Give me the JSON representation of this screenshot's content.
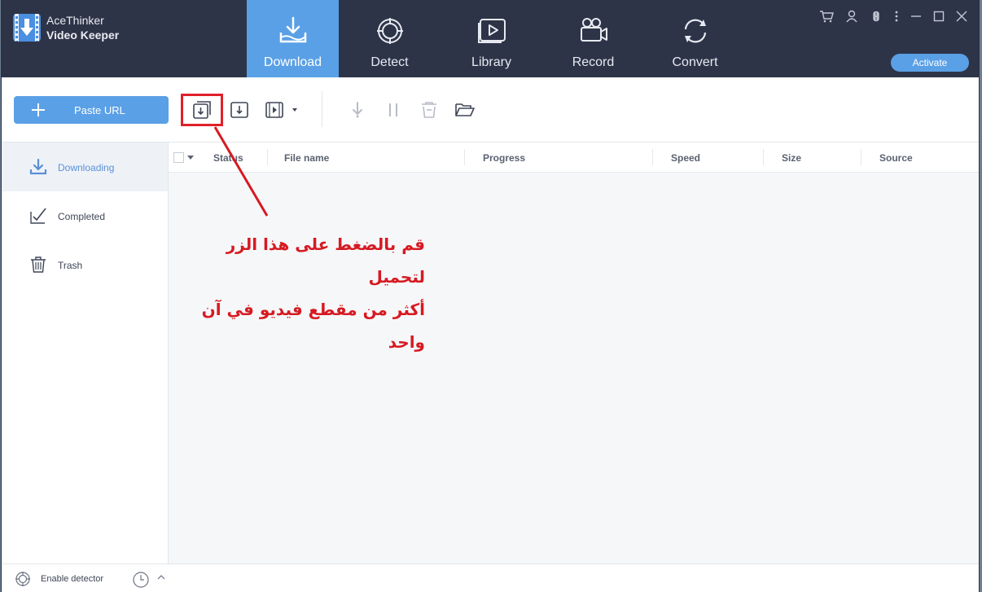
{
  "app": {
    "title_line1": "AceThinker",
    "title_line2": "Video Keeper"
  },
  "nav": {
    "tabs": [
      {
        "label": "Download",
        "icon": "download-tray-icon",
        "active": true
      },
      {
        "label": "Detect",
        "icon": "detect-target-icon",
        "active": false
      },
      {
        "label": "Library",
        "icon": "library-play-icon",
        "active": false
      },
      {
        "label": "Record",
        "icon": "record-camera-icon",
        "active": false
      },
      {
        "label": "Convert",
        "icon": "convert-cycle-icon",
        "active": false
      }
    ],
    "activate_label": "Activate"
  },
  "window_controls": [
    "cart-icon",
    "user-icon",
    "command-icon",
    "more-icon",
    "minimize-icon",
    "maximize-icon",
    "close-icon"
  ],
  "toolbar": {
    "paste_url_label": "Paste URL",
    "icons": [
      "batch-download-icon",
      "single-download-icon",
      "video-format-icon",
      "resume-icon",
      "pause-icon",
      "delete-icon",
      "open-folder-icon"
    ]
  },
  "sidebar": {
    "items": [
      {
        "label": "Downloading",
        "icon": "download-arrow-icon",
        "active": true
      },
      {
        "label": "Completed",
        "icon": "checkmark-icon",
        "active": false
      },
      {
        "label": "Trash",
        "icon": "trash-icon",
        "active": false
      }
    ]
  },
  "table": {
    "columns": [
      "Status",
      "File name",
      "Progress",
      "Speed",
      "Size",
      "Source"
    ],
    "rows": []
  },
  "annotation": {
    "line1": "قم بالضغط على هذا الزر لتحميل",
    "line2": "أكثر من مقطع فيديو في آن واحد"
  },
  "statusbar": {
    "detector_label": "Enable detector"
  },
  "colors": {
    "nav_bg": "#2e3448",
    "accent": "#5aa0e6",
    "annotation_red": "#d61a22"
  }
}
